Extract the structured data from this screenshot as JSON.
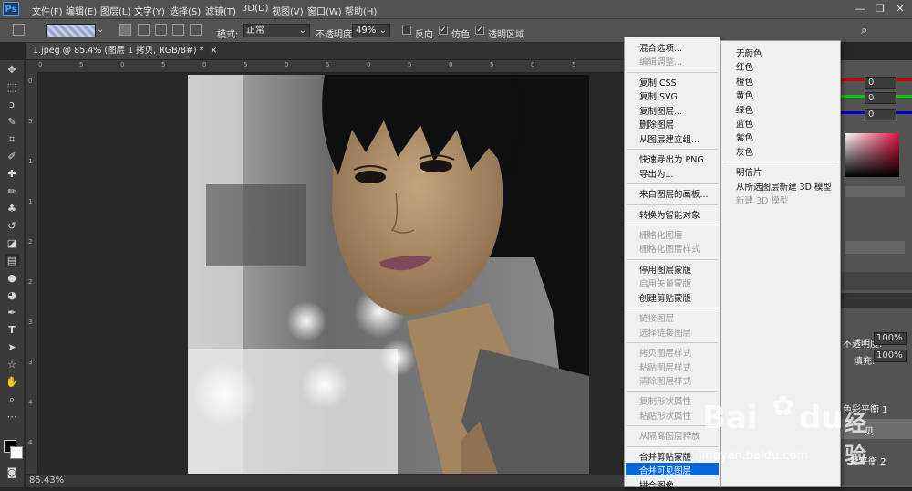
{
  "app": {
    "logo": "Ps"
  },
  "menubar": {
    "items": [
      "文件(F)",
      "编辑(E)",
      "图层(L)",
      "文字(Y)",
      "选择(S)",
      "滤镜(T)",
      "3D(D)",
      "视图(V)",
      "窗口(W)",
      "帮助(H)"
    ],
    "window_controls": [
      "—",
      "❐",
      "✕"
    ]
  },
  "options": {
    "mode_label": "模式:",
    "mode_value": "正常",
    "opacity_label": "不透明度:",
    "opacity_value": "49%",
    "reverse_label": "反向",
    "dither_label": "仿色",
    "transparency_label": "透明区域"
  },
  "document": {
    "tab_title": "1.jpeg @ 85.4% (图层 1 拷贝, RGB/8#) *",
    "close_icon": "×",
    "zoom_status": "85.43%"
  },
  "rulers": {
    "h": [
      "0",
      "5",
      "0",
      "5",
      "0",
      "5",
      "0",
      "5",
      "0",
      "5",
      "0",
      "5",
      "0",
      "5"
    ],
    "v": [
      "0",
      "5",
      "1",
      "1",
      "2",
      "2",
      "3",
      "3",
      "4",
      "4"
    ]
  },
  "panels": {
    "color_values": [
      "0",
      "0",
      "0"
    ],
    "layer_labels": {
      "opacity_label": "不透明度:",
      "opacity_value": "100%",
      "fill_label": "填充:",
      "fill_value": "100%",
      "layer_1": "色彩平衡 1",
      "layer_2": "贝",
      "layer_3": "彩平衡 2"
    }
  },
  "context_menu": {
    "items": [
      {
        "label": "混合选项...",
        "enabled": true
      },
      {
        "label": "编辑调整...",
        "enabled": false
      },
      {
        "sep": true
      },
      {
        "label": "复制 CSS",
        "enabled": true
      },
      {
        "label": "复制 SVG",
        "enabled": true
      },
      {
        "label": "复制图层...",
        "enabled": true
      },
      {
        "label": "删除图层",
        "enabled": true
      },
      {
        "label": "从图层建立组...",
        "enabled": true
      },
      {
        "sep": true
      },
      {
        "label": "快速导出为 PNG",
        "enabled": true
      },
      {
        "label": "导出为...",
        "enabled": true
      },
      {
        "sep": true
      },
      {
        "label": "来自图层的画板...",
        "enabled": true
      },
      {
        "sep": true
      },
      {
        "label": "转换为智能对象",
        "enabled": true
      },
      {
        "sep": true
      },
      {
        "label": "栅格化图层",
        "enabled": false
      },
      {
        "label": "栅格化图层样式",
        "enabled": false
      },
      {
        "sep": true
      },
      {
        "label": "停用图层蒙版",
        "enabled": true
      },
      {
        "label": "启用矢量蒙版",
        "enabled": false
      },
      {
        "label": "创建剪贴蒙版",
        "enabled": true
      },
      {
        "sep": true
      },
      {
        "label": "链接图层",
        "enabled": false
      },
      {
        "label": "选择链接图层",
        "enabled": false
      },
      {
        "sep": true
      },
      {
        "label": "拷贝图层样式",
        "enabled": false
      },
      {
        "label": "粘贴图层样式",
        "enabled": false
      },
      {
        "label": "清除图层样式",
        "enabled": false
      },
      {
        "sep": true
      },
      {
        "label": "复制形状属性",
        "enabled": false
      },
      {
        "label": "粘贴形状属性",
        "enabled": false
      },
      {
        "sep": true
      },
      {
        "label": "从隔离图层释放",
        "enabled": false
      },
      {
        "sep": true
      },
      {
        "label": "合并剪贴蒙版",
        "enabled": true
      },
      {
        "label": "合并可见图层",
        "enabled": true,
        "highlighted": true
      },
      {
        "label": "拼合图像",
        "enabled": true
      }
    ]
  },
  "submenu": {
    "items": [
      {
        "label": "无颜色",
        "enabled": true
      },
      {
        "label": "红色",
        "enabled": true
      },
      {
        "label": "橙色",
        "enabled": true
      },
      {
        "label": "黄色",
        "enabled": true
      },
      {
        "label": "绿色",
        "enabled": true
      },
      {
        "label": "蓝色",
        "enabled": true
      },
      {
        "label": "紫色",
        "enabled": true
      },
      {
        "label": "灰色",
        "enabled": true
      },
      {
        "sep": true
      },
      {
        "label": "明信片",
        "enabled": true
      },
      {
        "label": "从所选图层新建 3D 模型",
        "enabled": true
      },
      {
        "label": "新建 3D 模型",
        "enabled": false
      }
    ]
  },
  "watermark": {
    "brand": "Bai",
    "brand2": "du",
    "cn": "经验",
    "url": "jingyan.baidu.com"
  },
  "colors": {
    "highlight": "#0a67d8",
    "menu_bg": "#f0f0f0",
    "ps_blue": "#4ba3ff"
  }
}
